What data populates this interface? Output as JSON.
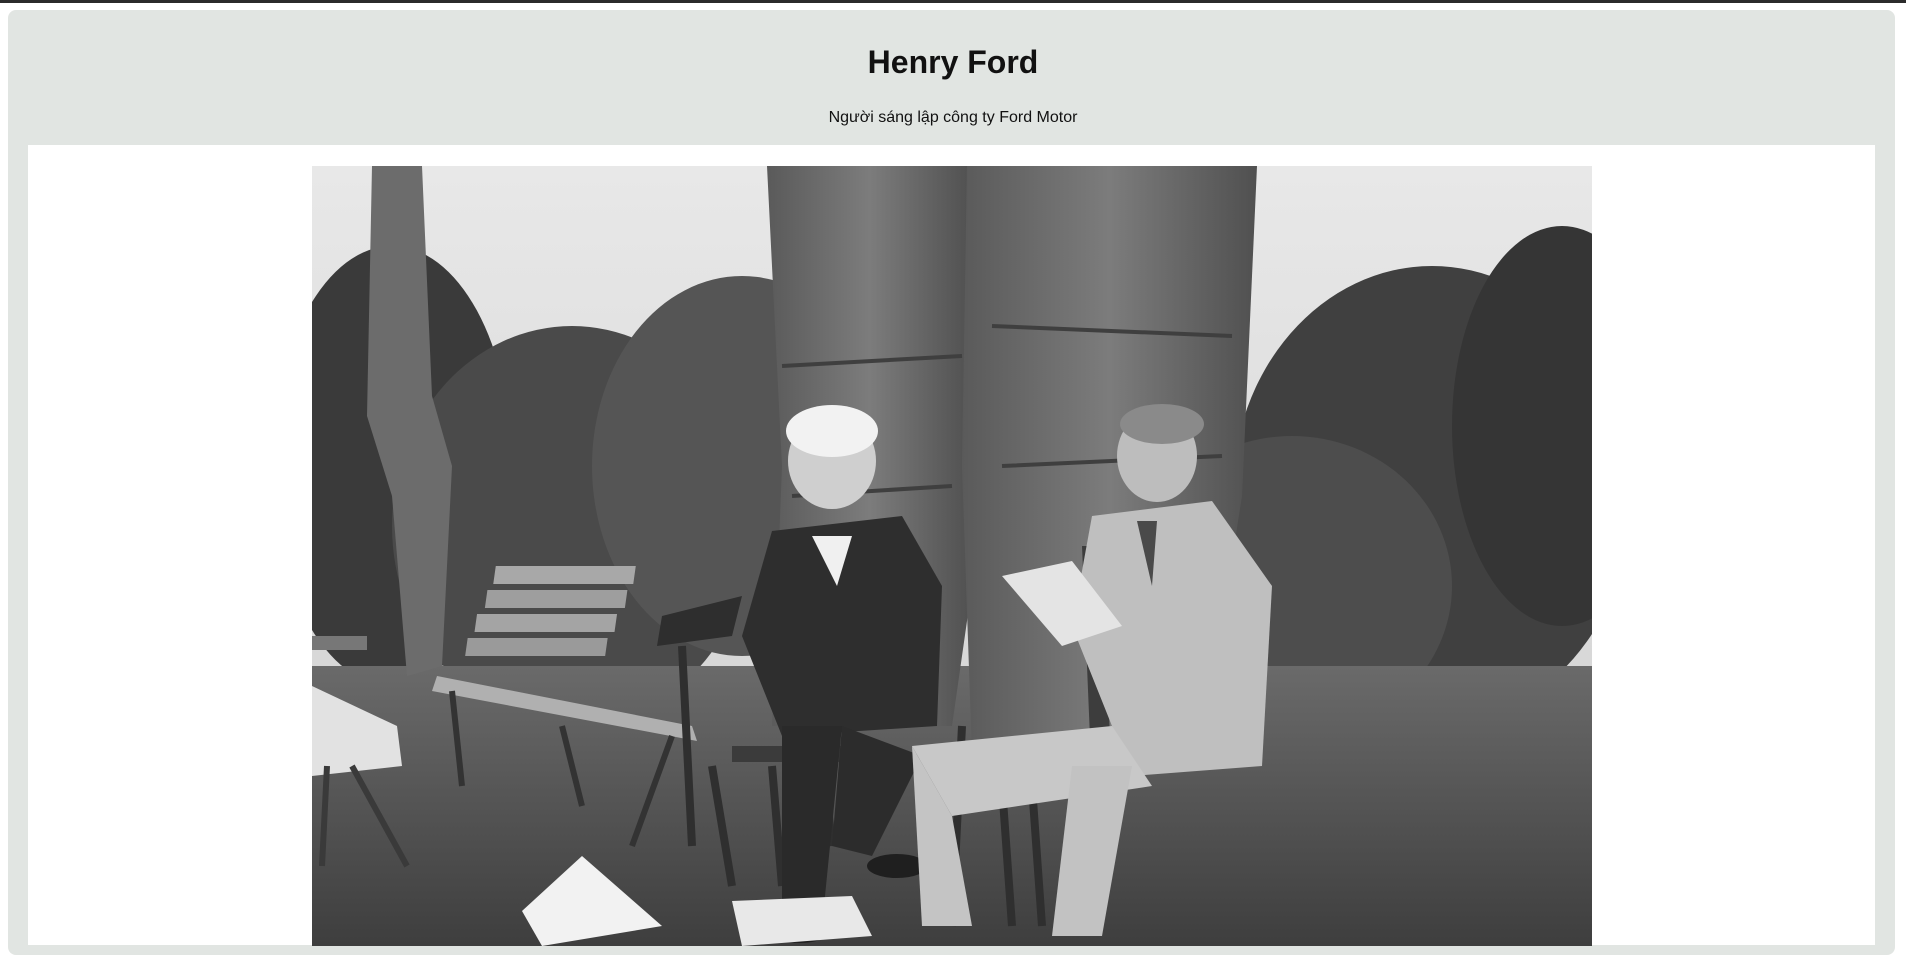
{
  "header": {
    "title": "Henry Ford",
    "subtitle": "Người sáng lập công ty Ford Motor"
  },
  "photo": {
    "icon": "photograph-image",
    "color_mode": "black-and-white"
  },
  "colors": {
    "page_background": "#e1e5e2",
    "panel_background": "#ffffff",
    "text": "#111111"
  }
}
